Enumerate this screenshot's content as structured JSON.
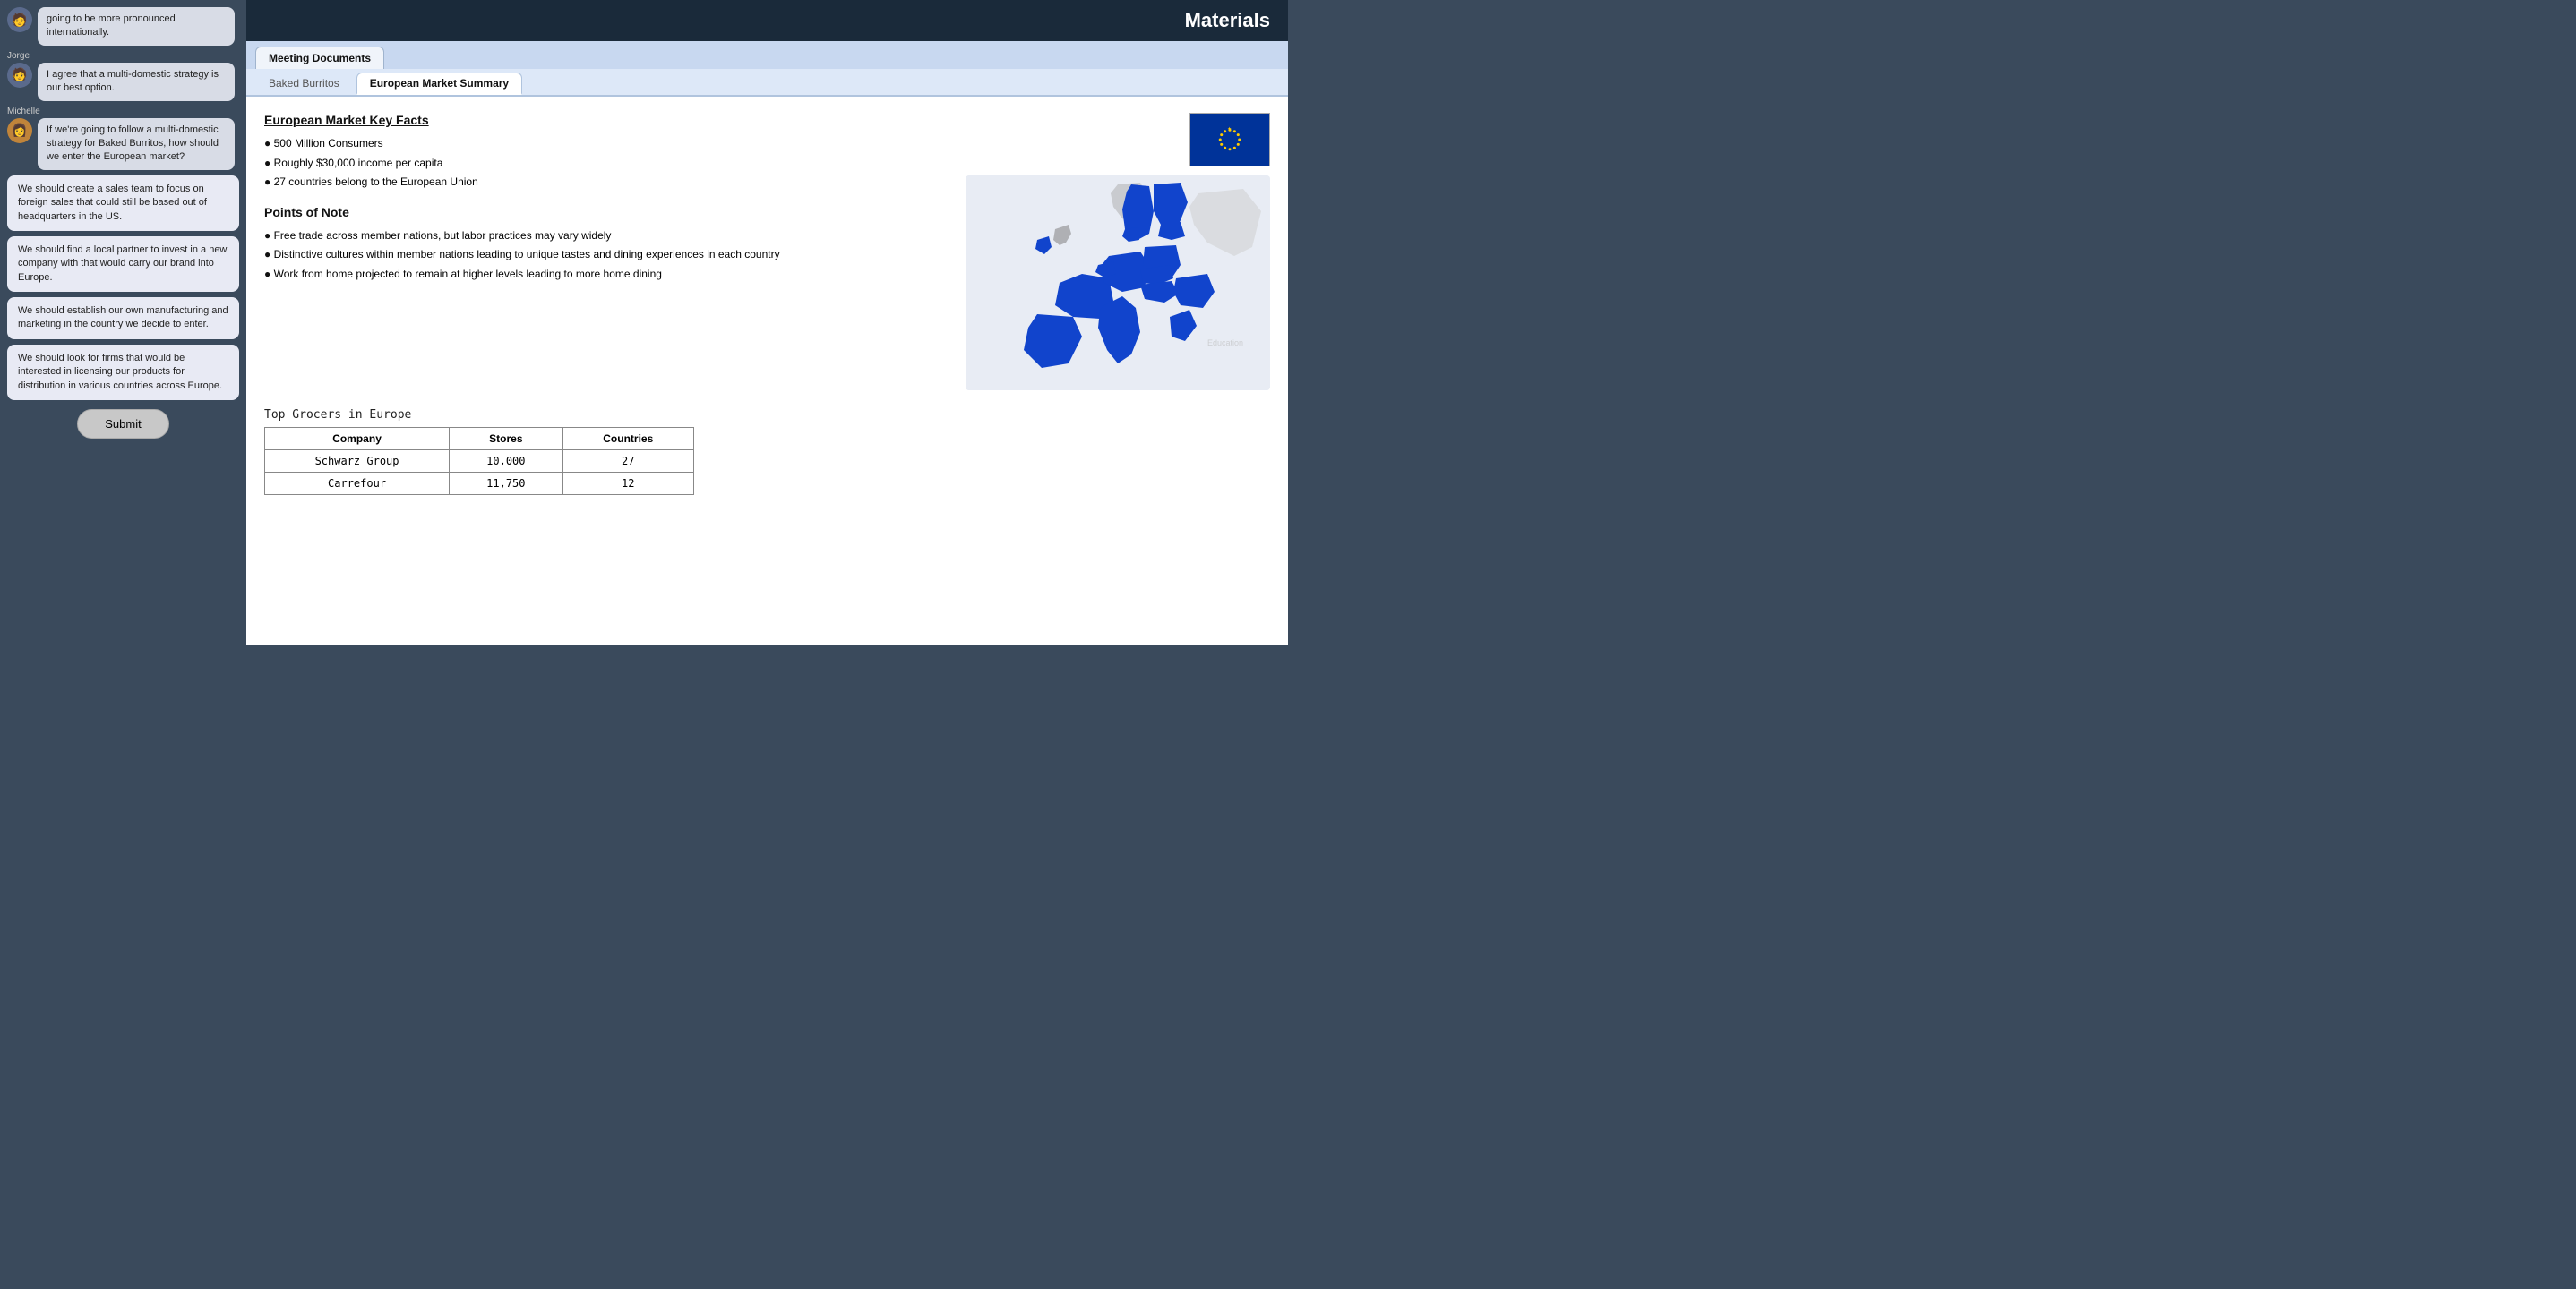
{
  "header": {
    "title": "Materials"
  },
  "tabs": {
    "main": [
      {
        "label": "Meeting Documents",
        "active": true
      }
    ],
    "sub": [
      {
        "label": "Baked Burritos",
        "active": false
      },
      {
        "label": "European Market Summary",
        "active": true
      }
    ]
  },
  "chat": {
    "messages": [
      {
        "speaker": "",
        "avatar": "jorge",
        "text": "going to be more pronounced internationally."
      },
      {
        "speaker": "Jorge",
        "avatar": "jorge",
        "text": "I agree that a multi-domestic strategy is our best option."
      },
      {
        "speaker": "Michelle",
        "avatar": "michelle",
        "text": "If we're going to follow a multi-domestic strategy for Baked Burritos, how should we enter the European market?"
      }
    ],
    "options": [
      "We should create a sales team to focus on foreign sales that could still be based out of headquarters in the US.",
      "We should find a local partner to invest in a new company with that would carry our brand into Europe.",
      "We should establish our own manufacturing and marketing in the country we decide to enter.",
      "We should look for firms that would be interested in licensing our products for distribution in various countries across Europe."
    ],
    "submit_label": "Submit"
  },
  "document": {
    "key_facts_title": "European Market Key Facts",
    "key_facts": [
      "500 Million Consumers",
      "Roughly $30,000 income per capita",
      "27 countries belong to the European Union"
    ],
    "points_title": "Points of Note",
    "points": [
      "Free trade across member nations, but labor practices may vary widely",
      "Distinctive cultures within member nations leading to unique tastes and dining experiences in each country",
      "Work from home projected to remain at higher levels leading to more home dining"
    ],
    "table_title": "Top Grocers in Europe",
    "table_headers": [
      "Company",
      "Stores",
      "Countries"
    ],
    "table_rows": [
      [
        "Schwarz Group",
        "10,000",
        "27"
      ],
      [
        "Carrefour",
        "11,750",
        "12"
      ]
    ]
  }
}
